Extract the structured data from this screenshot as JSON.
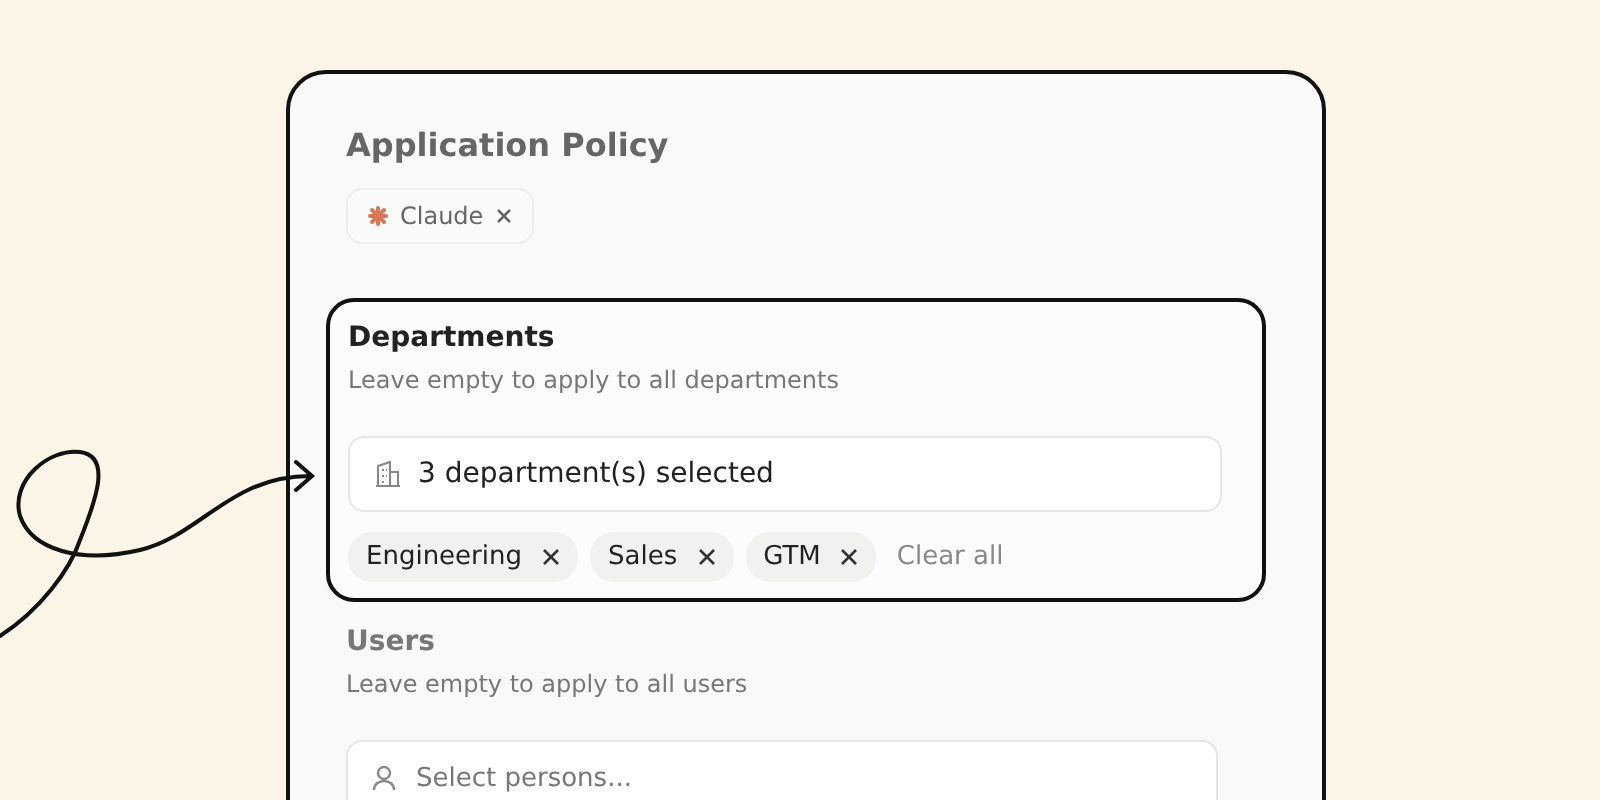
{
  "policy": {
    "title": "Application Policy",
    "applications": [
      {
        "label": "Claude"
      }
    ]
  },
  "departments": {
    "label": "Departments",
    "hint": "Leave empty to apply to all departments",
    "value": "3 department(s) selected",
    "chips": [
      {
        "label": "Engineering"
      },
      {
        "label": "Sales"
      },
      {
        "label": "GTM"
      }
    ],
    "clear": "Clear all"
  },
  "users": {
    "label": "Users",
    "hint": "Leave empty to apply to all users",
    "placeholder": "Select persons..."
  }
}
